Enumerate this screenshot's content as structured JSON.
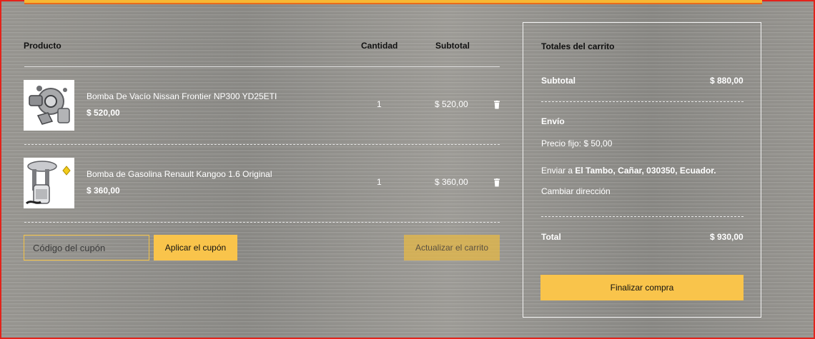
{
  "cart": {
    "headers": {
      "product": "Producto",
      "quantity": "Cantidad",
      "subtotal": "Subtotal"
    },
    "items": [
      {
        "name": "Bomba De Vacío Nissan Frontier NP300 YD25ETI",
        "price": "$ 520,00",
        "quantity": "1",
        "subtotal": "$ 520,00",
        "image_icon": "vacuum-pump-product-image",
        "remove_icon": "trash-icon"
      },
      {
        "name": "Bomba de Gasolina Renault Kangoo 1.6 Original",
        "price": "$ 360,00",
        "quantity": "1",
        "subtotal": "$ 360,00",
        "image_icon": "fuel-pump-product-image",
        "remove_icon": "trash-icon"
      }
    ],
    "coupon": {
      "placeholder": "Código del cupón",
      "value": ""
    },
    "apply_coupon_label": "Aplicar el cupón",
    "update_cart_label": "Actualizar el carrito"
  },
  "totals": {
    "title": "Totales del carrito",
    "subtotal_label": "Subtotal",
    "subtotal_value": "$ 880,00",
    "shipping_label": "Envío",
    "flat_rate": "Precio fijo: $ 50,00",
    "ship_to_prefix": "Enviar a",
    "ship_to_address": "El Tambo, Cañar, 030350, Ecuador.",
    "change_address_label": "Cambiar dirección",
    "total_label": "Total",
    "total_value": "$ 930,00",
    "checkout_label": "Finalizar compra"
  },
  "colors": {
    "accent": "#f9c44b",
    "frame_border": "#e3231b",
    "background": "#8f8e8a"
  }
}
